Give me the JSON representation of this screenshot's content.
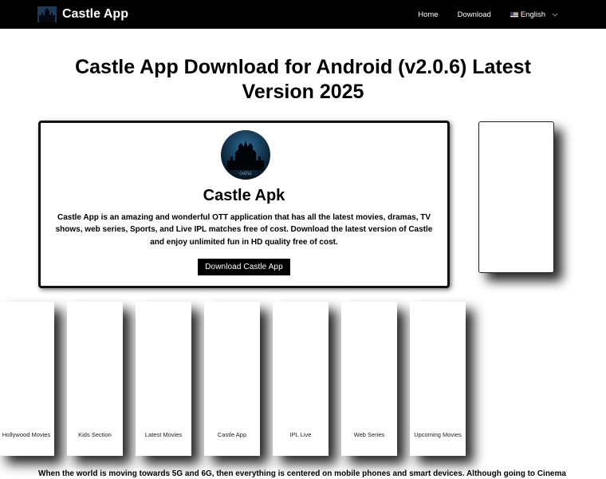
{
  "header": {
    "brand": "Castle App",
    "nav": [
      {
        "label": "Home"
      },
      {
        "label": "Download"
      }
    ],
    "language": "English"
  },
  "hero": {
    "title_line1": "Castle App Download for Android (v2.0.6) Latest",
    "title_line2": "Version 2025"
  },
  "card": {
    "title": "Castle Apk",
    "description": "Castle App is an amazing and wonderful OTT application that has all the latest movies, dramas, TV shows, web series, Sports, and Live IPL matches free of cost. Download the latest version of Castle and enjoy unlimited fun in HD quality free of cost.",
    "button": "Download Castle App",
    "icon_caption": "CASTLE"
  },
  "categories": [
    {
      "label": "Hollywood Movies"
    },
    {
      "label": "Kids Section"
    },
    {
      "label": "Latest Movies"
    },
    {
      "label": "Castle App"
    },
    {
      "label": "IPL Live"
    },
    {
      "label": "Web Series"
    },
    {
      "label": "Upcoming Movies"
    }
  ],
  "article": {
    "first_line": "When the world is moving towards 5G and 6G, then everything is centered on mobile phones and smart devices. Although going to Cinema and"
  },
  "colors": {
    "topbar": "#000000",
    "button": "#000000",
    "icon_bg": "#0b2a44"
  }
}
